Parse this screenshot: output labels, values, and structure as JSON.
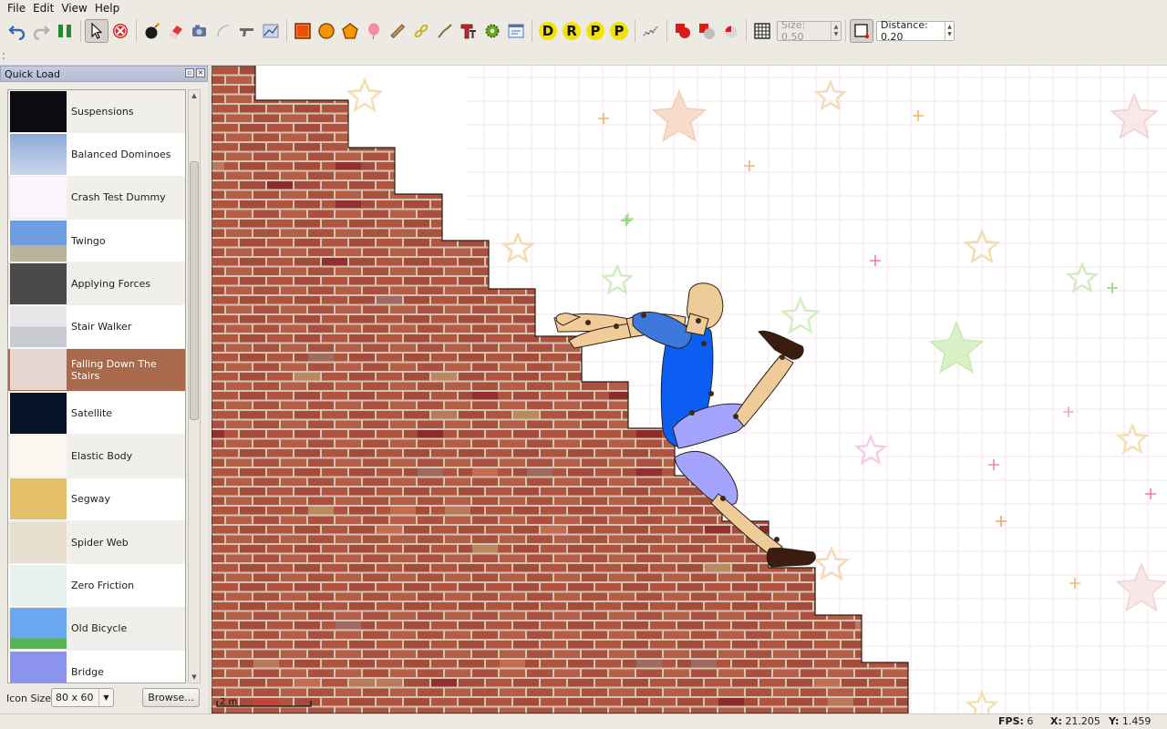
{
  "menu": [
    "File",
    "Edit",
    "View",
    "Help"
  ],
  "toolbar": {
    "letters": [
      "D",
      "R",
      "P",
      "P"
    ],
    "size_field": "Size: 0.50",
    "distance_field": "Distance: 0.20"
  },
  "dock": {
    "title": "Quick Load",
    "items": [
      {
        "label": "Suspensions",
        "thumb": "dark"
      },
      {
        "label": "Balanced Dominoes",
        "thumb": "sky-pyramid"
      },
      {
        "label": "Crash Test Dummy",
        "thumb": "stars"
      },
      {
        "label": "Twingo",
        "thumb": "sky-ground"
      },
      {
        "label": "Applying Forces",
        "thumb": "gray"
      },
      {
        "label": "Stair Walker",
        "thumb": "stairs"
      },
      {
        "label": "Falling Down The Stairs",
        "thumb": "brick",
        "selected": true
      },
      {
        "label": "Satellite",
        "thumb": "space"
      },
      {
        "label": "Elastic Body",
        "thumb": "stars2"
      },
      {
        "label": "Segway",
        "thumb": "sand"
      },
      {
        "label": "Spider Web",
        "thumb": "web"
      },
      {
        "label": "Zero Friction",
        "thumb": "ice"
      },
      {
        "label": "Old Bicycle",
        "thumb": "sky-bike"
      },
      {
        "label": "Bridge",
        "thumb": "purple"
      }
    ],
    "icon_size_label": "Icon Size",
    "icon_size_value": "80 x 60",
    "browse_label": "Browse..."
  },
  "world": {
    "scale_label": "2 m",
    "brick_color": "#a8503f",
    "mortar_color": "#d9c7b6"
  },
  "status": {
    "fps_label": "FPS:",
    "fps_value": "6",
    "x_label": "X:",
    "x_value": "21.205",
    "y_label": "Y:",
    "y_value": "1.459"
  }
}
